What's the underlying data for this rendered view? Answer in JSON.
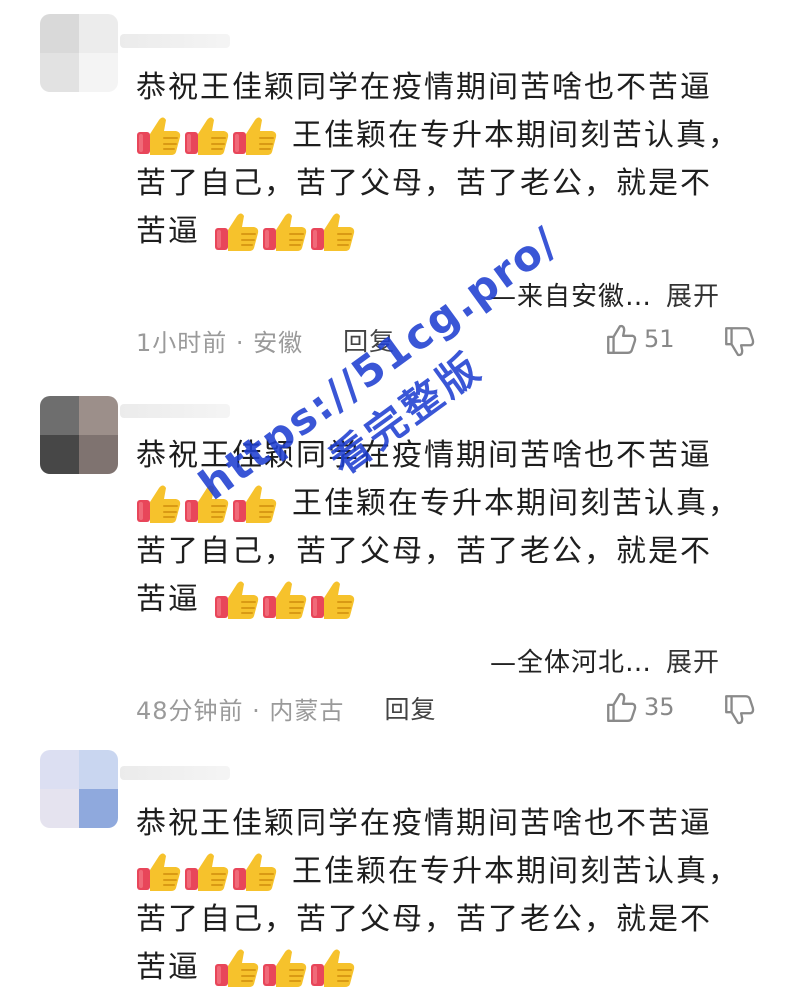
{
  "comments": [
    {
      "line1": "恭祝王佳颖同学在疫情期间苦啥也不苦逼",
      "line2": "王佳颖在专升本期间刻苦认真，",
      "line3": "苦了自己，苦了父母，苦了老公，就是不",
      "line4": "苦逼",
      "signature": "—来自安徽…",
      "expand": "展开",
      "time_location": "1小时前 · 安徽",
      "reply": "回复",
      "likes": "51",
      "avatar_colors": [
        "#d9d9d9",
        "#ececec",
        "#e2e2e2",
        "#f4f4f4"
      ]
    },
    {
      "line1": "恭祝王佳颖同学在疫情期间苦啥也不苦逼",
      "line2": "王佳颖在专升本期间刻苦认真，",
      "line3": "苦了自己，苦了父母，苦了老公，就是不",
      "line4": "苦逼",
      "signature": "—全体河北…",
      "expand": "展开",
      "time_location": "48分钟前 · 内蒙古",
      "reply": "回复",
      "likes": "35",
      "avatar_colors": [
        "#6e6e6e",
        "#9c8f8a",
        "#474747",
        "#7f7370"
      ]
    },
    {
      "line1": "恭祝王佳颖同学在疫情期间苦啥也不苦逼",
      "line2": "王佳颖在专升本期间刻苦认真，",
      "line3": "苦了自己，苦了父母，苦了老公，就是不",
      "line4": "苦逼",
      "avatar_colors": [
        "#dcdff2",
        "#c9d6f0",
        "#e5e3ef",
        "#8fa9dd"
      ]
    }
  ],
  "watermark": {
    "url": "https://51cg.pro/",
    "text": "看完整版",
    "color": "#1f3fd1"
  },
  "icons": {
    "thumbs_up_emoji": "thumbs-up-emoji",
    "like": "thumb-up-outline-icon",
    "dislike": "thumb-down-outline-icon"
  },
  "colors": {
    "thumb_yellow": "#f6c22c",
    "thumb_cuff_red": "#e8465a",
    "meta_gray": "#9a9a9a"
  }
}
